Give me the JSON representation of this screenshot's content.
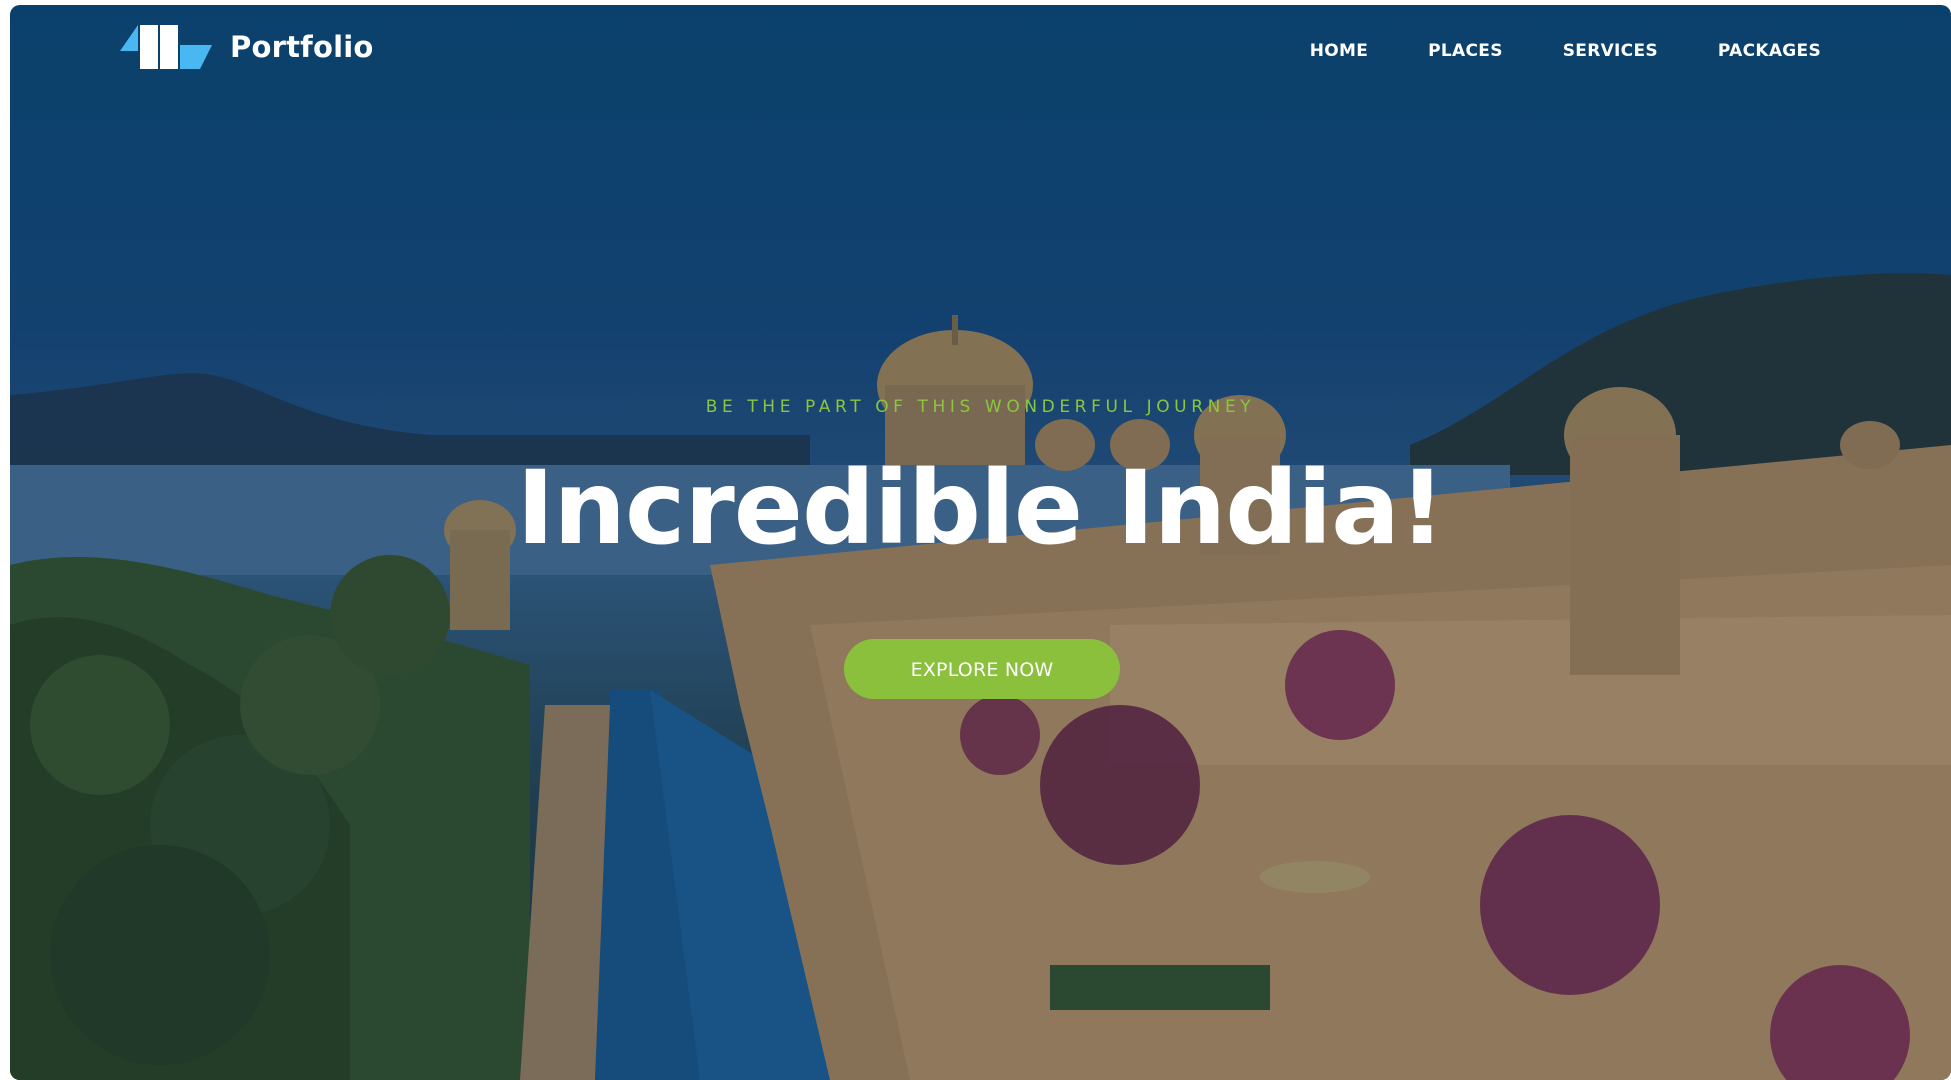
{
  "brand": {
    "name": "Portfolio",
    "logo_icon": "portfolio-logo-icon"
  },
  "nav": {
    "items": [
      {
        "label": "HOME"
      },
      {
        "label": "PLACES"
      },
      {
        "label": "SERVICES"
      },
      {
        "label": "PACKAGES"
      }
    ]
  },
  "hero": {
    "tagline": "BE THE PART OF THIS WONDERFUL JOURNEY",
    "headline": "Incredible India!",
    "cta_label": "EXPLORE NOW",
    "background_image": "palace-hotel-lake-photo"
  },
  "colors": {
    "accent": "#8ac03c",
    "tagline": "#8cc63f",
    "logo_light": "#49b8f2",
    "logo_white": "#ffffff",
    "overlay": "#0c4f7e"
  }
}
